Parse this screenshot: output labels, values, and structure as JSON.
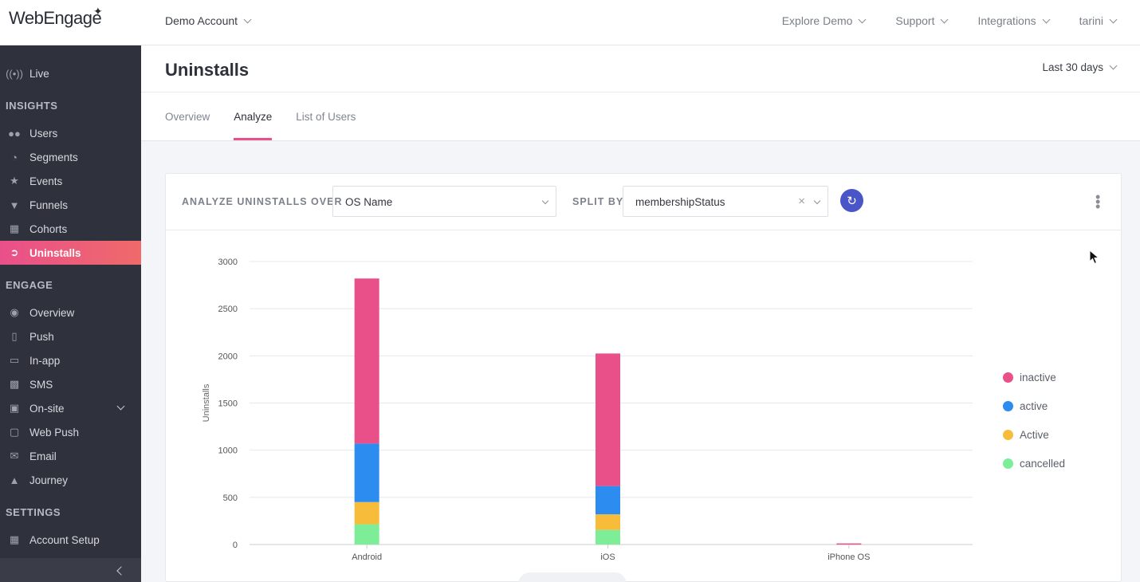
{
  "header": {
    "logo_text": "WebEngage",
    "account": "Demo Account",
    "nav": [
      "Explore Demo",
      "Support",
      "Integrations",
      "tarini"
    ]
  },
  "sidebar": {
    "live": "Live",
    "sections": {
      "insights": "INSIGHTS",
      "engage": "ENGAGE",
      "settings": "SETTINGS"
    },
    "insights_items": [
      "Users",
      "Segments",
      "Events",
      "Funnels",
      "Cohorts",
      "Uninstalls"
    ],
    "engage_items": [
      "Overview",
      "Push",
      "In-app",
      "SMS",
      "On-site",
      "Web Push",
      "Email",
      "Journey"
    ],
    "settings_items": [
      "Account Setup"
    ],
    "active_item": "Uninstalls"
  },
  "page": {
    "title": "Uninstalls",
    "date_range": "Last 30 days",
    "tabs": [
      "Overview",
      "Analyze",
      "List of Users"
    ],
    "active_tab": "Analyze"
  },
  "controls": {
    "analyze_label": "ANALYZE UNINSTALLS OVER",
    "analyze_value": "OS Name",
    "split_label": "SPLIT BY",
    "split_value": "membershipStatus"
  },
  "colors": {
    "inactive": "#e9508a",
    "active": "#2d8cf0",
    "Active": "#f7bd3a",
    "cancelled": "#7ded97",
    "accent": "#e9508a",
    "refresh": "#4a56c8"
  },
  "chart_data": {
    "type": "bar",
    "stacked": true,
    "ylabel": "Uninstalls",
    "xlabel": "",
    "ylim": [
      0,
      3000
    ],
    "yticks": [
      0,
      500,
      1000,
      1500,
      2000,
      2500,
      3000
    ],
    "categories": [
      "Android",
      "iOS",
      "iPhone OS"
    ],
    "series": [
      {
        "name": "cancelled",
        "values": [
          215,
          155,
          0
        ]
      },
      {
        "name": "Active",
        "values": [
          235,
          165,
          0
        ]
      },
      {
        "name": "active",
        "values": [
          620,
          300,
          0
        ]
      },
      {
        "name": "inactive",
        "values": [
          1750,
          1405,
          12
        ]
      }
    ],
    "legend_position": "right",
    "legend_order": [
      "inactive",
      "active",
      "Active",
      "cancelled"
    ],
    "grid": true
  }
}
